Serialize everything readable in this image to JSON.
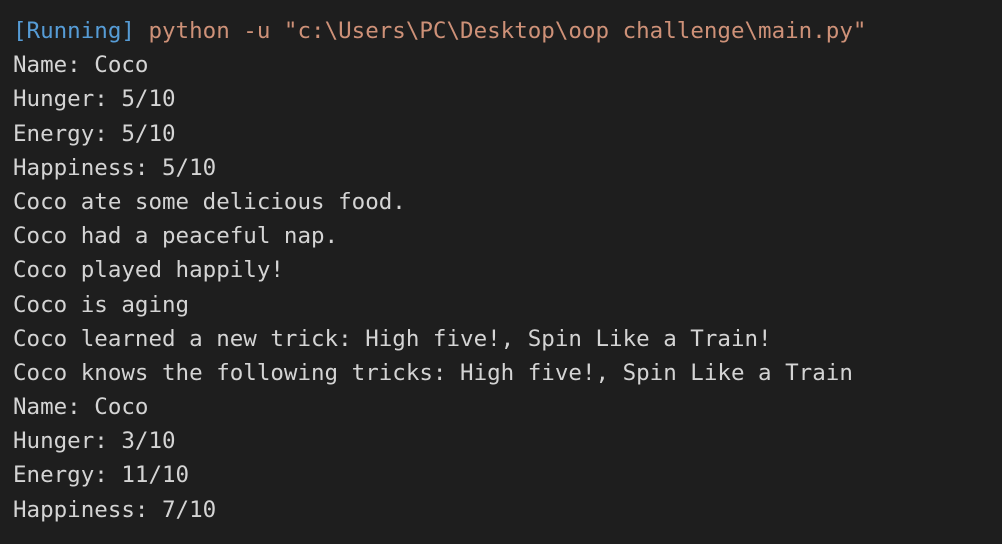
{
  "run_header": {
    "status": "[Running]",
    "command": " python -u \"c:\\Users\\PC\\Desktop\\oop challenge\\main.py\""
  },
  "output_lines": [
    "Name: Coco",
    "Hunger: 5/10",
    "Energy: 5/10",
    "Happiness: 5/10",
    "Coco ate some delicious food.",
    "Coco had a peaceful nap.",
    "Coco played happily!",
    "Coco is aging",
    "Coco learned a new trick: High five!, Spin Like a Train!",
    "Coco knows the following tricks: High five!, Spin Like a Train",
    "Name: Coco",
    "Hunger: 3/10",
    "Energy: 11/10",
    "Happiness: 7/10"
  ],
  "colors": {
    "background": "#1e1e1e",
    "text": "#d4d4d4",
    "running_tag": "#569cd6",
    "command": "#ce9178"
  }
}
